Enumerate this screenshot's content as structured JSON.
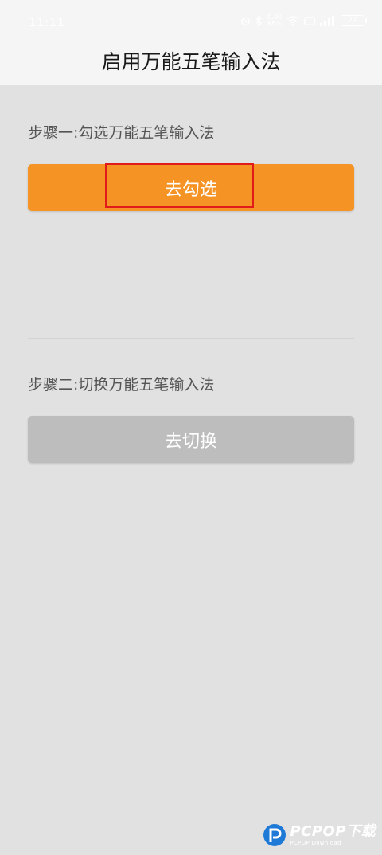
{
  "status_bar": {
    "time": "11:11",
    "network_speed": "0.00\nKB/s",
    "battery": "27"
  },
  "header": {
    "title": "启用万能五笔输入法"
  },
  "steps": [
    {
      "label": "步骤一:勾选万能五笔输入法",
      "button": "去勾选"
    },
    {
      "label": "步骤二:切换万能五笔输入法",
      "button": "去切换"
    }
  ],
  "watermark": {
    "text": "PCPOP下载",
    "sub": "PCPOP Download"
  },
  "colors": {
    "accent": "#f59424",
    "disabled": "#bdbdbd",
    "highlight": "#e11a1a",
    "background": "#e1e1e1",
    "header_bg": "#f5f5f5"
  }
}
